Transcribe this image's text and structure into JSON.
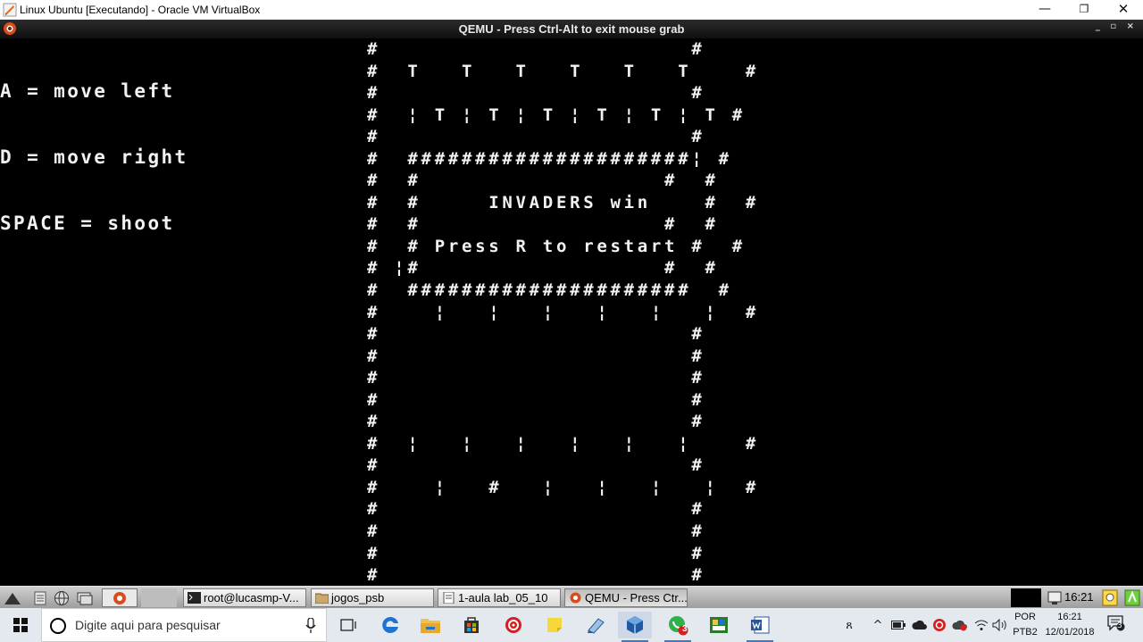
{
  "host_window": {
    "title": "Linux Ubuntu [Executando] - Oracle VM VirtualBox",
    "controls": {
      "minimize": "—",
      "maximize": "❐",
      "close": "✕"
    }
  },
  "qemu_window": {
    "title": "QEMU - Press Ctrl-Alt to exit mouse grab",
    "controls": "_ ▫ ×"
  },
  "console": {
    "help_lines": [
      "A = move left",
      "D = move right",
      "SPACE = shoot"
    ],
    "game_rows": [
      "#                       #",
      "#  T   T   T   T   T   T    #",
      "#                       #",
      "#  ¦ T ¦ T ¦ T ¦ T ¦ T ¦ T #",
      "#                       #",
      "#  #####################¦ #",
      "#  #                  #  #",
      "#  #     INVADERS win    #  #",
      "#  #                  #  #",
      "#  # Press R to restart #  #",
      "# ¦#                  #  #",
      "#  #####################  #",
      "#    ¦   ¦   ¦   ¦   ¦   ¦  #",
      "#                       #",
      "#                       #",
      "#                       #",
      "#                       #",
      "#                       #",
      "#  ¦   ¦   ¦   ¦   ¦   ¦    #",
      "#                       #",
      "#    ¦   #   ¦   ¦   ¦   ¦  #",
      "#                       #",
      "#                       #",
      "#                       #",
      "#                       #"
    ]
  },
  "guest_taskbar": {
    "tasks": [
      {
        "label": "root@lucasmp-V...",
        "icon": "terminal-icon"
      },
      {
        "label": "jogos_psb",
        "icon": "folder-icon"
      },
      {
        "label": "1-aula lab_05_10",
        "icon": "document-icon"
      },
      {
        "label": "QEMU - Press Ctr...",
        "icon": "qemu-icon"
      }
    ],
    "clock": "16:21"
  },
  "windows_taskbar": {
    "search_placeholder": "Digite aqui para pesquisar",
    "language_top": "POR",
    "language_bottom": "PTB2",
    "time": "16:21",
    "date": "12/01/2018",
    "whatsapp_badge": "3",
    "notification_badge": "3",
    "colors": {
      "taskbar_bg": "#e4e9f0",
      "accent": "#3f79c7",
      "edge_blue": "#1e73d2",
      "explorer_yellow": "#f2c14b"
    }
  }
}
